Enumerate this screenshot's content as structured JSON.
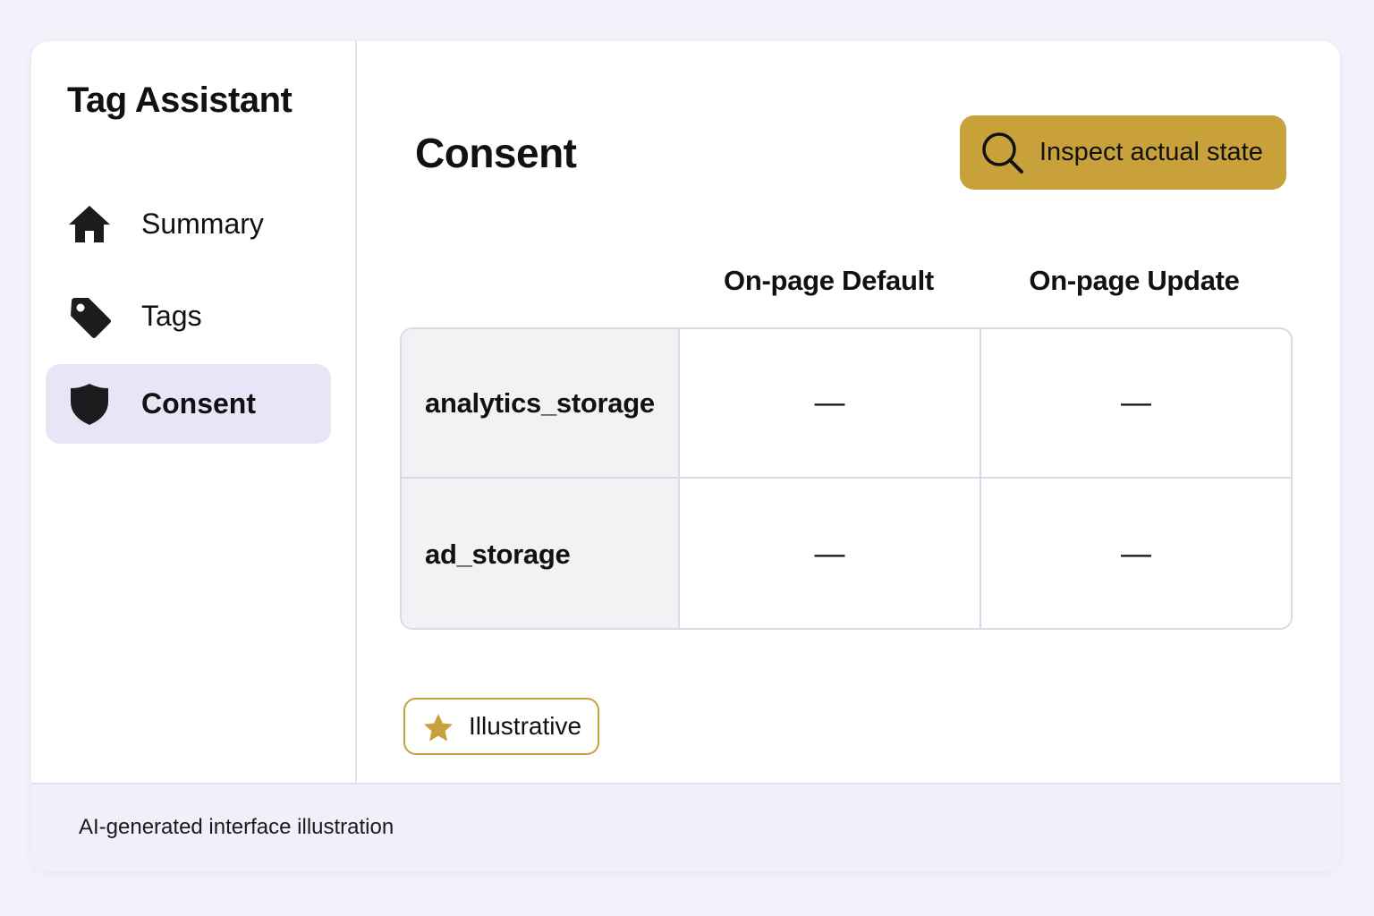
{
  "app": {
    "title": "Tag Assistant"
  },
  "sidebar": {
    "items": [
      {
        "label": "Summary",
        "icon": "home-icon",
        "active": false
      },
      {
        "label": "Tags",
        "icon": "tag-icon",
        "active": false
      },
      {
        "label": "Consent",
        "icon": "shield-icon",
        "active": true
      }
    ]
  },
  "main": {
    "title": "Consent",
    "inspect_button": {
      "label": "Inspect actual state",
      "icon": "search-icon"
    },
    "table": {
      "columns": [
        "On-page Default",
        "On-page Update"
      ],
      "rows": [
        {
          "key": "analytics_storage",
          "default": "—",
          "update": "—"
        },
        {
          "key": "ad_storage",
          "default": "—",
          "update": "—"
        }
      ]
    },
    "badge": {
      "label": "Illustrative",
      "icon": "star-icon"
    }
  },
  "footer": {
    "text": "AI-generated interface illustration"
  },
  "colors": {
    "accent": "#c9a13a",
    "active_nav_bg": "#e8e5f6",
    "page_bg": "#f3f1f9",
    "key_cell_bg": "#f2f2f4"
  }
}
